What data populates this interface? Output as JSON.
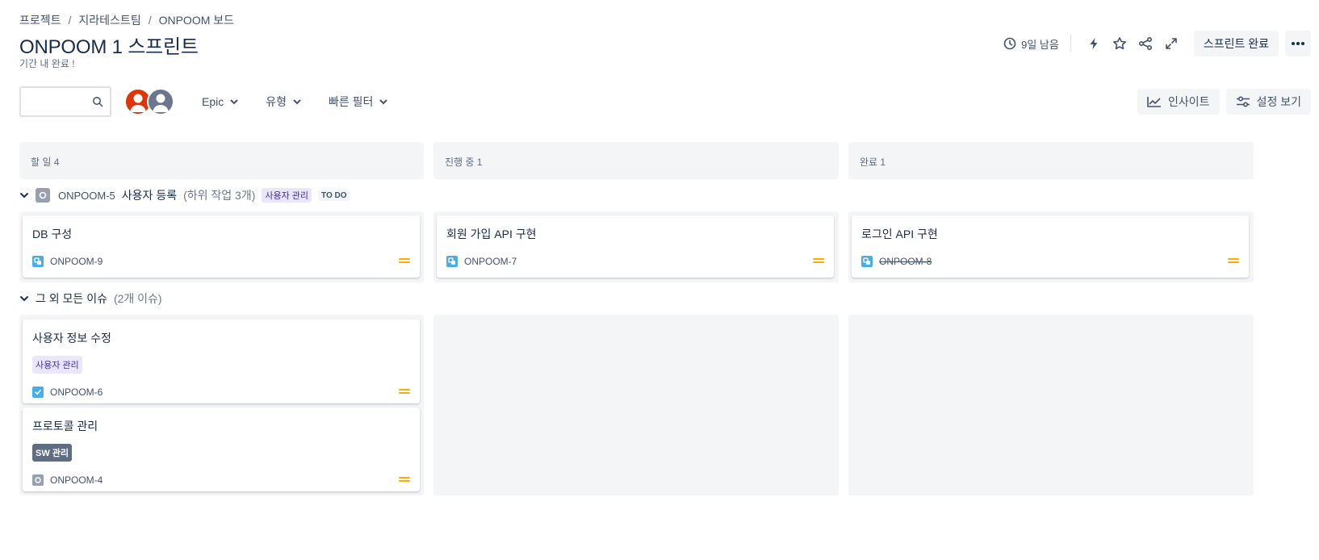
{
  "breadcrumb": [
    "프로젝트",
    "지라테스트팀",
    "ONPOOM 보드"
  ],
  "breadcrumb_sep": "/",
  "title": "ONPOOM 1 스프린트",
  "sprint_goal": "기간 내 완료 !",
  "header": {
    "time_remaining": "9일 남음",
    "complete_label": "스프린트 완료",
    "icons": [
      "clock-icon",
      "lightning-icon",
      "star-icon",
      "share-icon",
      "expand-icon",
      "more-icon"
    ]
  },
  "toolbar": {
    "search_placeholder": "",
    "filters": [
      "Epic",
      "유형",
      "빠른 필터"
    ],
    "insight_label": "인사이트",
    "settings_label": "설정 보기"
  },
  "columns": [
    {
      "name": "할 일 4"
    },
    {
      "name": "진행 중 1"
    },
    {
      "name": "완료 1"
    }
  ],
  "swimlanes": [
    {
      "key": "ONPOOM-5",
      "title": "사용자 등록",
      "count": "(하위 작업 3개)",
      "epic": "사용자 관리",
      "status": "TO DO",
      "cards": [
        {
          "column": 0,
          "title": "DB 구성",
          "key": "ONPOOM-9",
          "type": "subtask",
          "done": false
        },
        {
          "column": 1,
          "title": "회원 가입 API 구현",
          "key": "ONPOOM-7",
          "type": "subtask",
          "done": false
        },
        {
          "column": 2,
          "title": "로그인 API 구현",
          "key": "ONPOOM-8",
          "type": "subtask",
          "done": true
        }
      ]
    },
    {
      "title": "그 외 모든 이슈",
      "count": "(2개 이슈)",
      "cards": [
        {
          "column": 0,
          "title": "사용자 정보 수정",
          "label": "사용자 관리",
          "key": "ONPOOM-6",
          "type": "task"
        },
        {
          "column": 0,
          "title": "프로토콜 관리",
          "label": "SW 관리",
          "key": "ONPOOM-4",
          "type": "epic"
        }
      ]
    }
  ],
  "colors": {
    "priority_medium": "#ffab00",
    "accent_blue": "#4bade8",
    "epic_purple_bg": "#eae6ff",
    "avatar_red": "#de350b",
    "avatar_gray": "#6b778c"
  }
}
